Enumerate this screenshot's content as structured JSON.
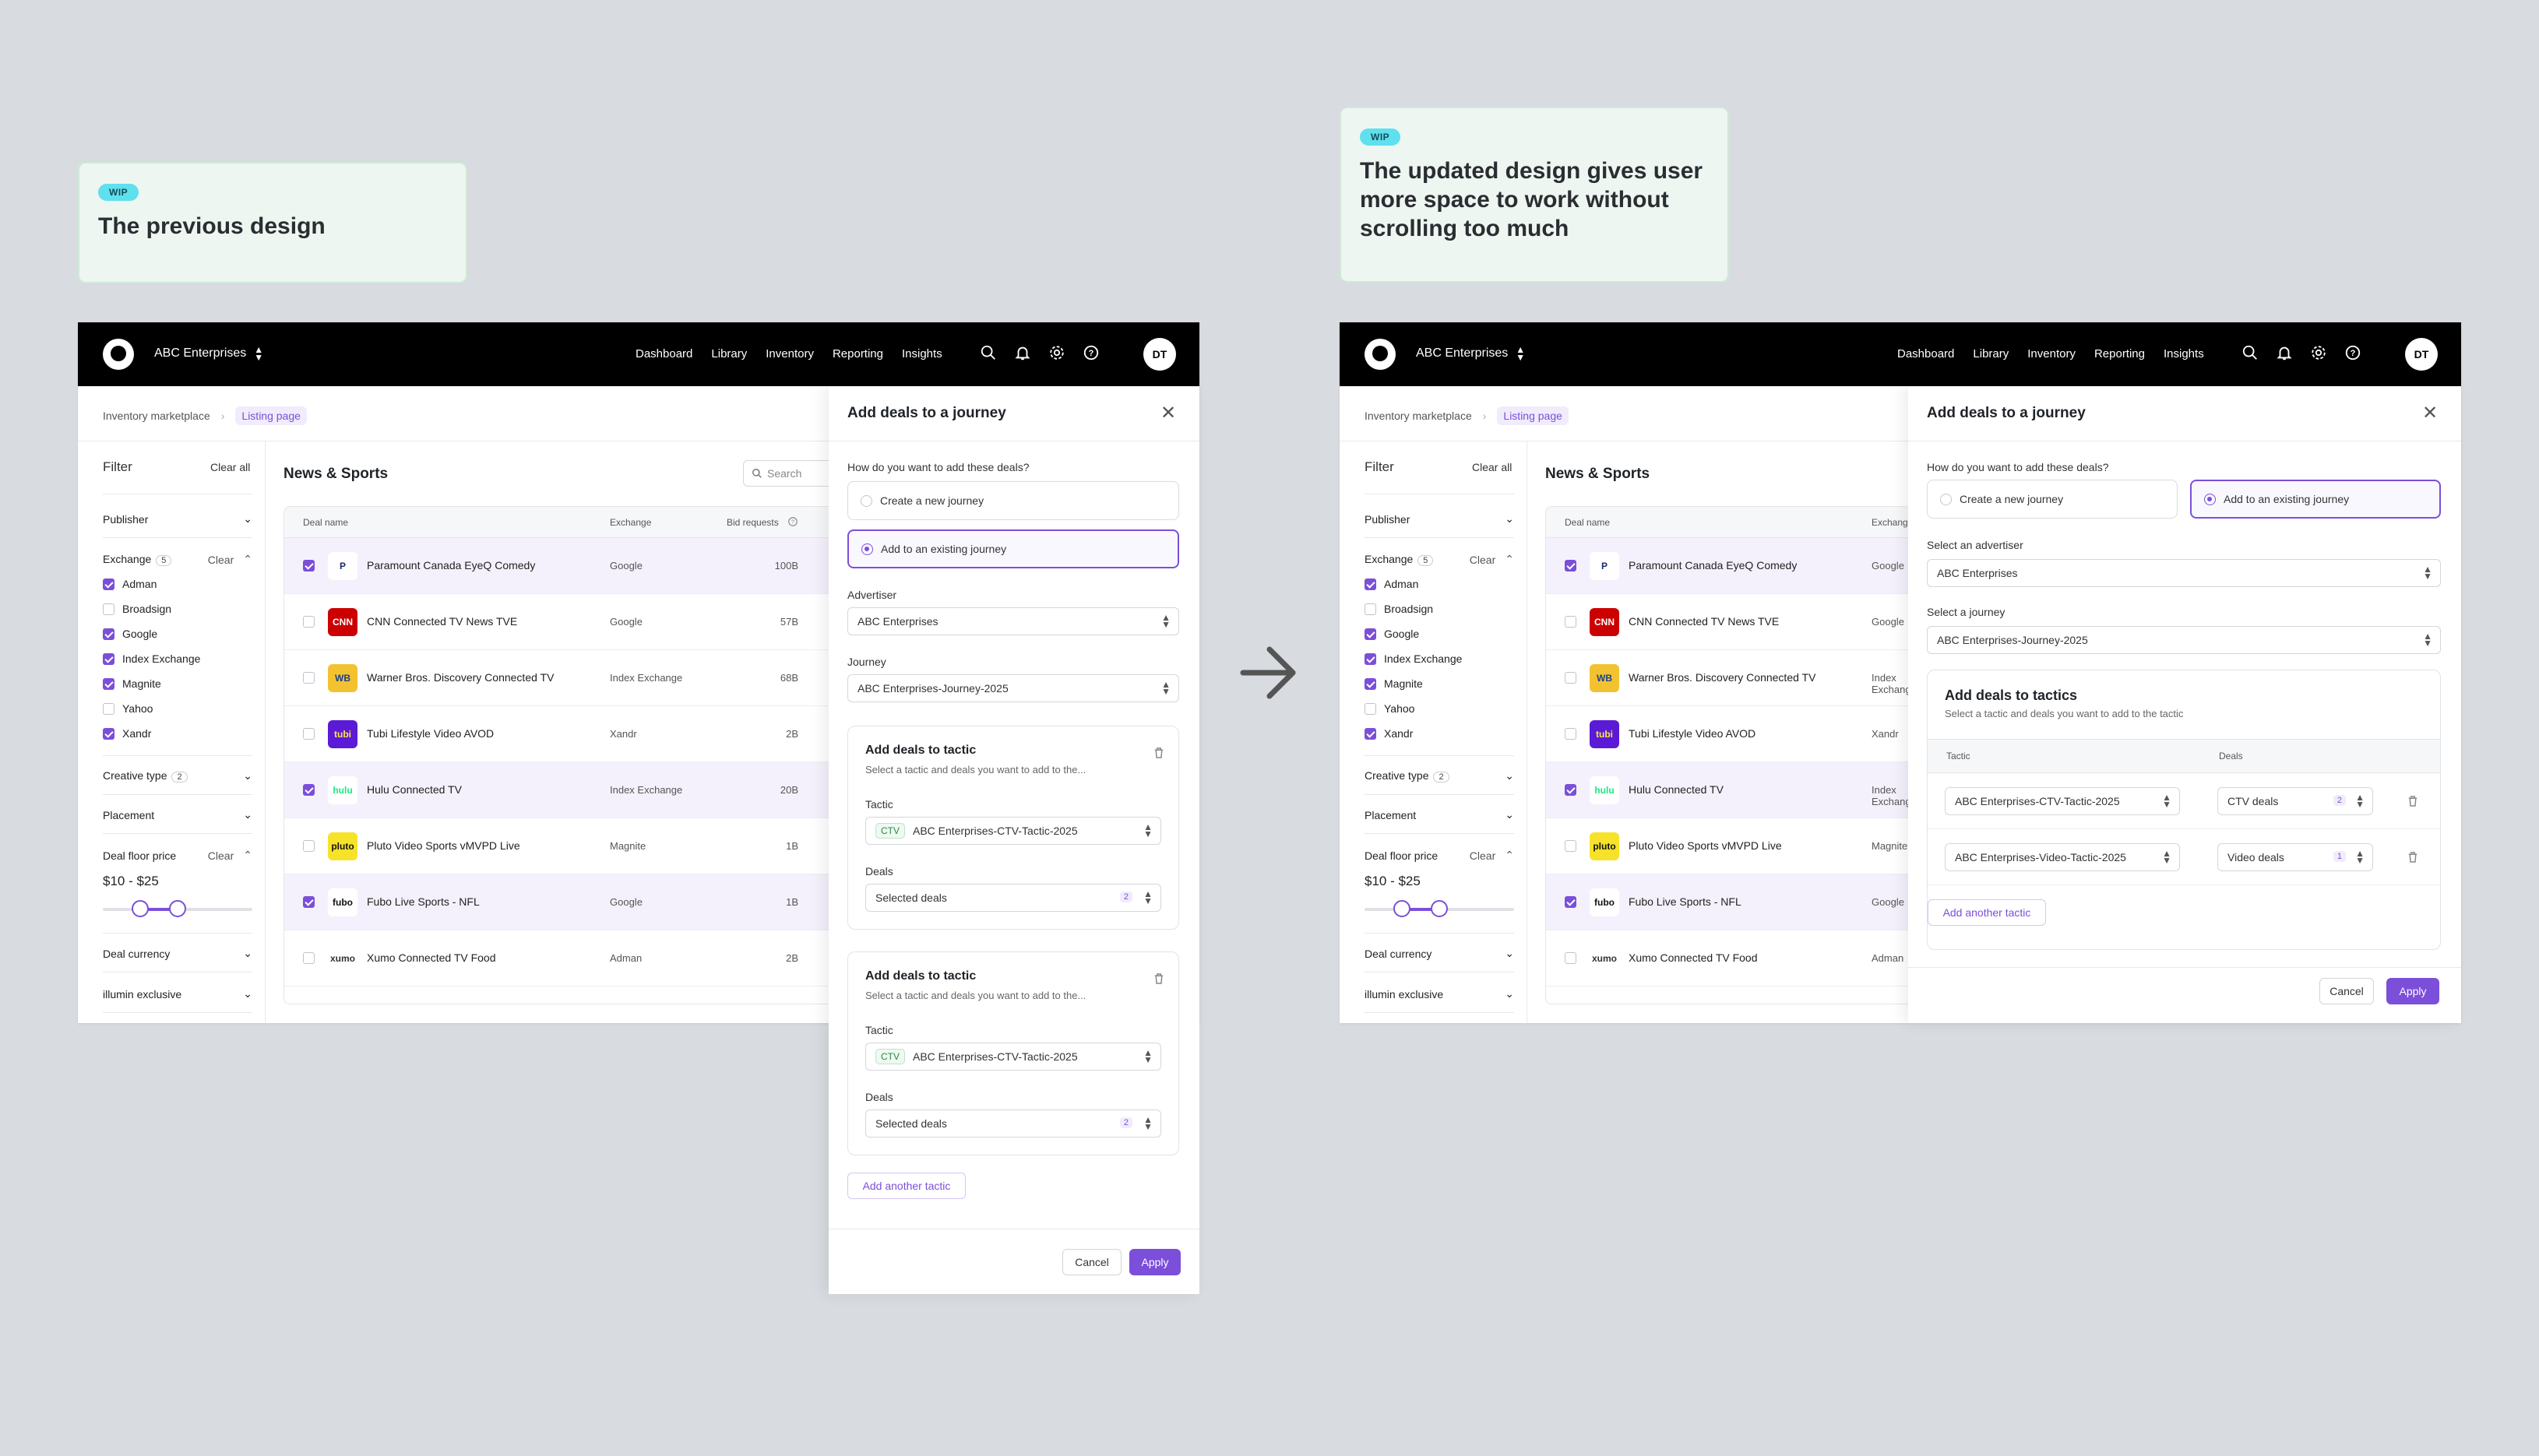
{
  "notes": [
    {
      "badge": "WIP",
      "text": "The previous design"
    },
    {
      "badge": "WIP",
      "text": "The updated design gives user more space to work without scrolling too much"
    }
  ],
  "app": {
    "org": "ABC Enterprises",
    "nav": [
      "Dashboard",
      "Library",
      "Inventory",
      "Reporting",
      "Insights"
    ],
    "avatar": "DT",
    "breadcrumb": [
      "Inventory marketplace",
      "Listing page"
    ],
    "filter": {
      "title": "Filter",
      "clear_all": "Clear all",
      "publisher": "Publisher",
      "exchange": "Exchange",
      "exchange_count": "5",
      "clear": "Clear",
      "exchanges": [
        {
          "label": "Adman",
          "checked": true
        },
        {
          "label": "Broadsign",
          "checked": false
        },
        {
          "label": "Google",
          "checked": true
        },
        {
          "label": "Index Exchange",
          "checked": true
        },
        {
          "label": "Magnite",
          "checked": true
        },
        {
          "label": "Yahoo",
          "checked": false
        },
        {
          "label": "Xandr",
          "checked": true
        }
      ],
      "creative_type": "Creative type",
      "creative_count": "2",
      "placement": "Placement",
      "deal_floor_price": "Deal floor price",
      "price_range": "$10 - $25",
      "deal_currency": "Deal currency",
      "illumin_exclusive": "illumin exclusive"
    },
    "section_title": "News & Sports",
    "search_placeholder": "Search",
    "table": {
      "headers": [
        "Deal name",
        "Exchange",
        "Bid requests"
      ],
      "rows": [
        {
          "name": "Paramount Canada EyeQ Comedy",
          "exchange": "Google",
          "bids": "100B",
          "checked": true,
          "logo": "paramount-logo",
          "logo_text": "P"
        },
        {
          "name": "CNN Connected TV News TVE",
          "exchange": "Google",
          "bids": "57B",
          "checked": false,
          "logo": "cnn-logo",
          "logo_text": "CNN"
        },
        {
          "name": "Warner Bros. Discovery Connected TV",
          "exchange": "Index Exchange",
          "bids": "68B",
          "checked": false,
          "logo": "wb-logo",
          "logo_text": "WB"
        },
        {
          "name": "Tubi Lifestyle Video AVOD",
          "exchange": "Xandr",
          "bids": "2B",
          "checked": false,
          "logo": "tubi-logo",
          "logo_text": "tubi"
        },
        {
          "name": "Hulu Connected TV",
          "exchange": "Index Exchange",
          "bids": "20B",
          "checked": true,
          "logo": "hulu-logo",
          "logo_text": "hulu"
        },
        {
          "name": "Pluto Video Sports vMVPD Live",
          "exchange": "Magnite",
          "bids": "1B",
          "checked": false,
          "logo": "pluto-logo",
          "logo_text": "pluto"
        },
        {
          "name": "Fubo Live Sports - NFL",
          "exchange": "Google",
          "bids": "1B",
          "checked": true,
          "logo": "fubo-logo",
          "logo_text": "fubo"
        },
        {
          "name": "Xumo Connected TV Food",
          "exchange": "Adman",
          "bids": "2B",
          "checked": false,
          "logo": "xumo-logo",
          "logo_text": "xumo"
        }
      ]
    }
  },
  "old_panel": {
    "title": "Add deals to a journey",
    "question": "How do you want to add these deals?",
    "opt_new": "Create a new journey",
    "opt_existing": "Add to an existing journey",
    "advertiser_label": "Advertiser",
    "advertiser_value": "ABC Enterprises",
    "journey_label": "Journey",
    "journey_value": "ABC Enterprises-Journey-2025",
    "tactic_cards": [
      {
        "title": "Add deals to tactic",
        "subtitle": "Select a tactic and deals you want to add to the...",
        "tactic_label": "Tactic",
        "pill": "CTV",
        "tactic_value": "ABC Enterprises-CTV-Tactic-2025",
        "deals_label": "Deals",
        "deals_value": "Selected deals",
        "deals_count": "2"
      },
      {
        "title": "Add deals to tactic",
        "subtitle": "Select a tactic and deals you want to add to the...",
        "tactic_label": "Tactic",
        "pill": "CTV",
        "tactic_value": "ABC Enterprises-CTV-Tactic-2025",
        "deals_label": "Deals",
        "deals_value": "Selected deals",
        "deals_count": "2"
      }
    ],
    "add_another": "Add another tactic",
    "cancel": "Cancel",
    "apply": "Apply"
  },
  "new_panel": {
    "title": "Add deals to a journey",
    "question": "How do you want to add these deals?",
    "opt_new": "Create a new journey",
    "opt_existing": "Add to an existing journey",
    "advertiser_label": "Select an advertiser",
    "advertiser_value": "ABC Enterprises",
    "journey_label": "Select a journey",
    "journey_value": "ABC Enterprises-Journey-2025",
    "tactics_title": "Add deals to tactics",
    "tactics_subtitle": "Select a tactic and deals you want to add to the tactic",
    "col_tactic": "Tactic",
    "col_deals": "Deals",
    "rows": [
      {
        "tactic": "ABC Enterprises-CTV-Tactic-2025",
        "deals": "CTV deals",
        "count": "2"
      },
      {
        "tactic": "ABC Enterprises-Video-Tactic-2025",
        "deals": "Video deals",
        "count": "1"
      }
    ],
    "add_another": "Add another tactic",
    "cancel": "Cancel",
    "apply": "Apply"
  },
  "colors": {
    "accent": "#7b4fd9",
    "topbar": "#000000",
    "background": "#d8dbe0",
    "note_bg": "#eef6f1"
  }
}
